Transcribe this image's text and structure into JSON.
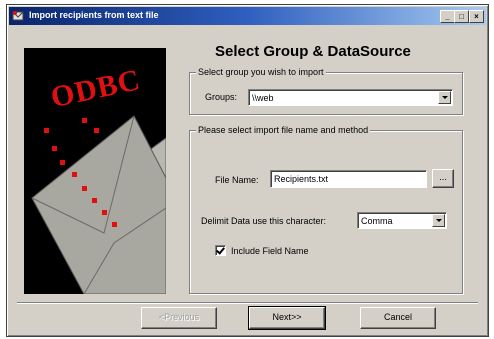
{
  "window": {
    "title": "Import recipients from text file",
    "title_buttons": [
      "_",
      "□",
      "×"
    ]
  },
  "heading": "Select Group & DataSource",
  "group_box": {
    "title": "Select group you wish to import",
    "label": "Groups:",
    "value": "\\\\web"
  },
  "file_box": {
    "title": "Please select import file name and method",
    "file_label": "File Name:",
    "file_value": "Recipients.txt",
    "browse_label": "...",
    "delimit_label": "Delimit Data use this character:",
    "delimit_value": "Comma",
    "include_label": "Include Field Name",
    "include_checked": true
  },
  "buttons": {
    "back": "<Previous",
    "next": "Next>>",
    "cancel": "Cancel"
  },
  "art": {
    "logo_text": "ODBC",
    "colors": {
      "background": "#000000",
      "logo": "#e01010",
      "envelope": "#a8a8a0"
    }
  },
  "icons": [
    "app-icon",
    "minimize-icon",
    "maximize-icon",
    "close-icon",
    "dropdown-arrow-icon",
    "checkmark-icon"
  ]
}
